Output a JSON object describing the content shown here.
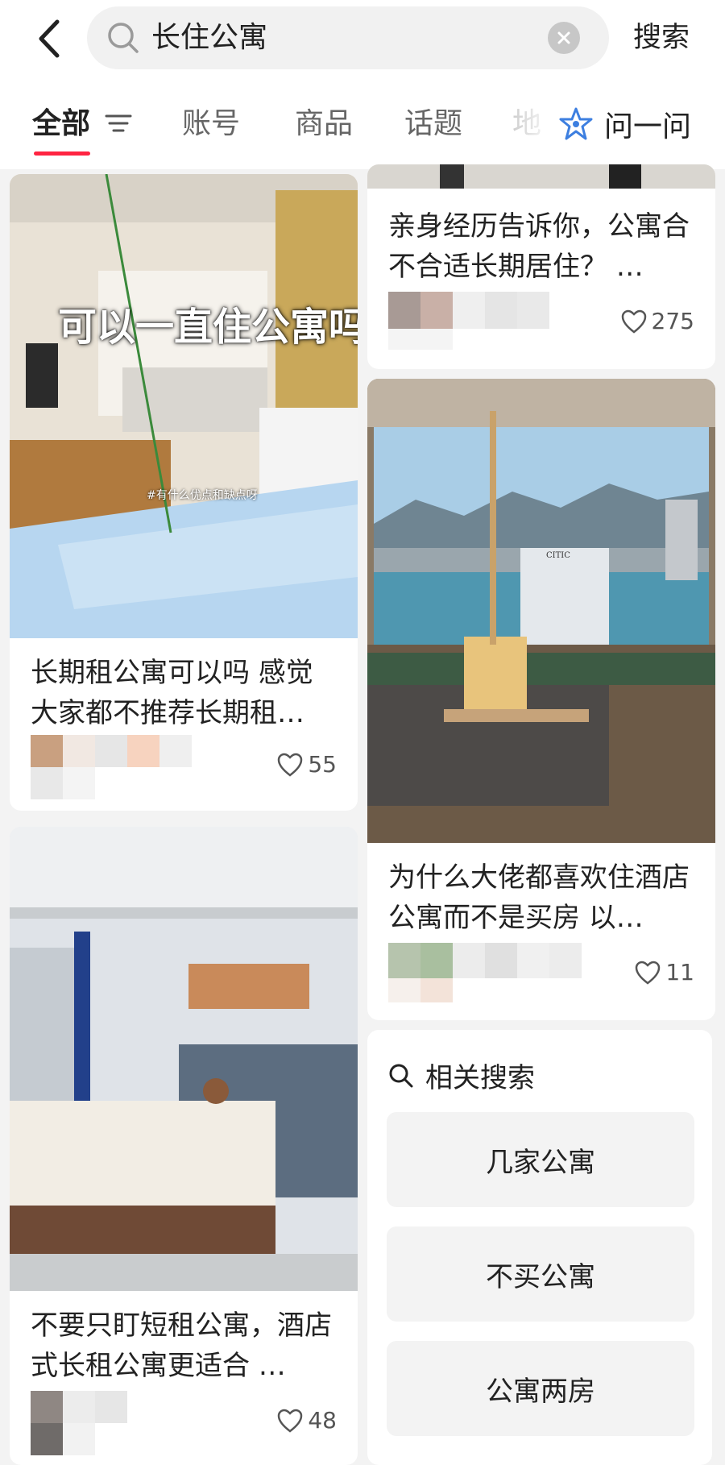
{
  "search": {
    "query": "长住公寓",
    "submit_label": "搜索"
  },
  "tabs": [
    {
      "label": "全部",
      "active": true
    },
    {
      "label": "账号",
      "active": false
    },
    {
      "label": "商品",
      "active": false
    },
    {
      "label": "话题",
      "active": false
    },
    {
      "label": "地",
      "active": false
    }
  ],
  "ask": {
    "label": "问一问"
  },
  "accent_color": "#ff2442",
  "cards": [
    {
      "image_caption": "可以一直住公寓吗",
      "image_subcaption": "#有什么优点和缺点呀",
      "title": "长期租公寓可以吗 感觉大家都不推荐长期租…",
      "likes": "55"
    },
    {
      "title": "亲身经历告诉你，公寓合不合适长期居住？ …",
      "likes": "275"
    },
    {
      "image_sign": "CITIC",
      "title": "为什么大佬都喜欢住酒店公寓而不是买房 以…",
      "likes": "11"
    },
    {
      "title": "不要只盯短租公寓，酒店式长租公寓更适合 …",
      "likes": "48"
    }
  ],
  "related": {
    "heading": "相关搜索",
    "items": [
      "几家公寓",
      "不买公寓",
      "公寓两房"
    ]
  }
}
